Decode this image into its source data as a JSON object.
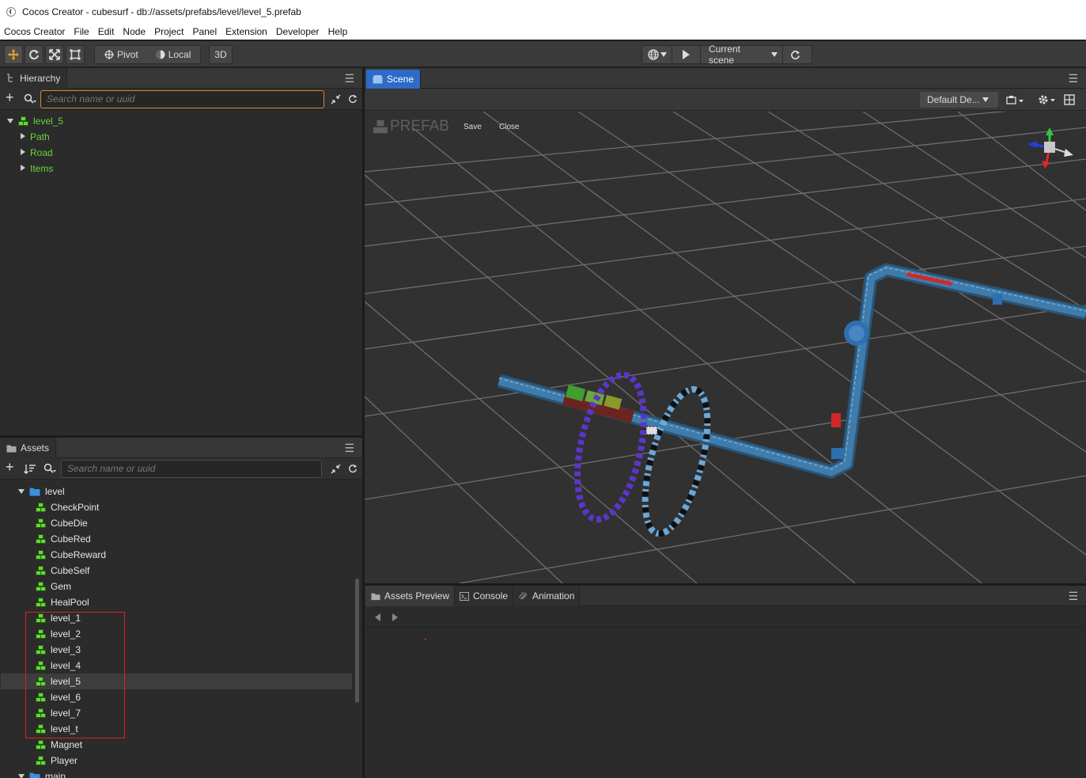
{
  "window": {
    "title": "Cocos Creator - cubesurf - db://assets/prefabs/level/level_5.prefab"
  },
  "menu": [
    "Cocos Creator",
    "File",
    "Edit",
    "Node",
    "Project",
    "Panel",
    "Extension",
    "Developer",
    "Help"
  ],
  "toolbar": {
    "pivot": "Pivot",
    "local": "Local",
    "mode3d": "3D",
    "scene_select": "Current scene"
  },
  "hierarchy": {
    "tab": "Hierarchy",
    "search_placeholder": "Search name or uuid",
    "root": "level_5",
    "children": [
      "Path",
      "Road",
      "Items"
    ]
  },
  "assets": {
    "tab": "Assets",
    "search_placeholder": "Search name or uuid",
    "folder": "level",
    "items": [
      "CheckPoint",
      "CubeDie",
      "CubeRed",
      "CubeReward",
      "CubeSelf",
      "Gem",
      "HealPool",
      "level_1",
      "level_2",
      "level_3",
      "level_4",
      "level_5",
      "level_6",
      "level_7",
      "level_t",
      "Magnet",
      "Player"
    ],
    "selected": "level_5",
    "next_folder": "main"
  },
  "scene": {
    "tab": "Scene",
    "camera_select": "Default De...",
    "prefab_label": "PREFAB",
    "save": "Save",
    "close": "Close"
  },
  "bottom": {
    "tabs": [
      "Assets Preview",
      "Console",
      "Animation"
    ]
  },
  "colors": {
    "accent": "#2d6bc7",
    "node_green": "#6cd43a",
    "highlight": "#e02020"
  }
}
